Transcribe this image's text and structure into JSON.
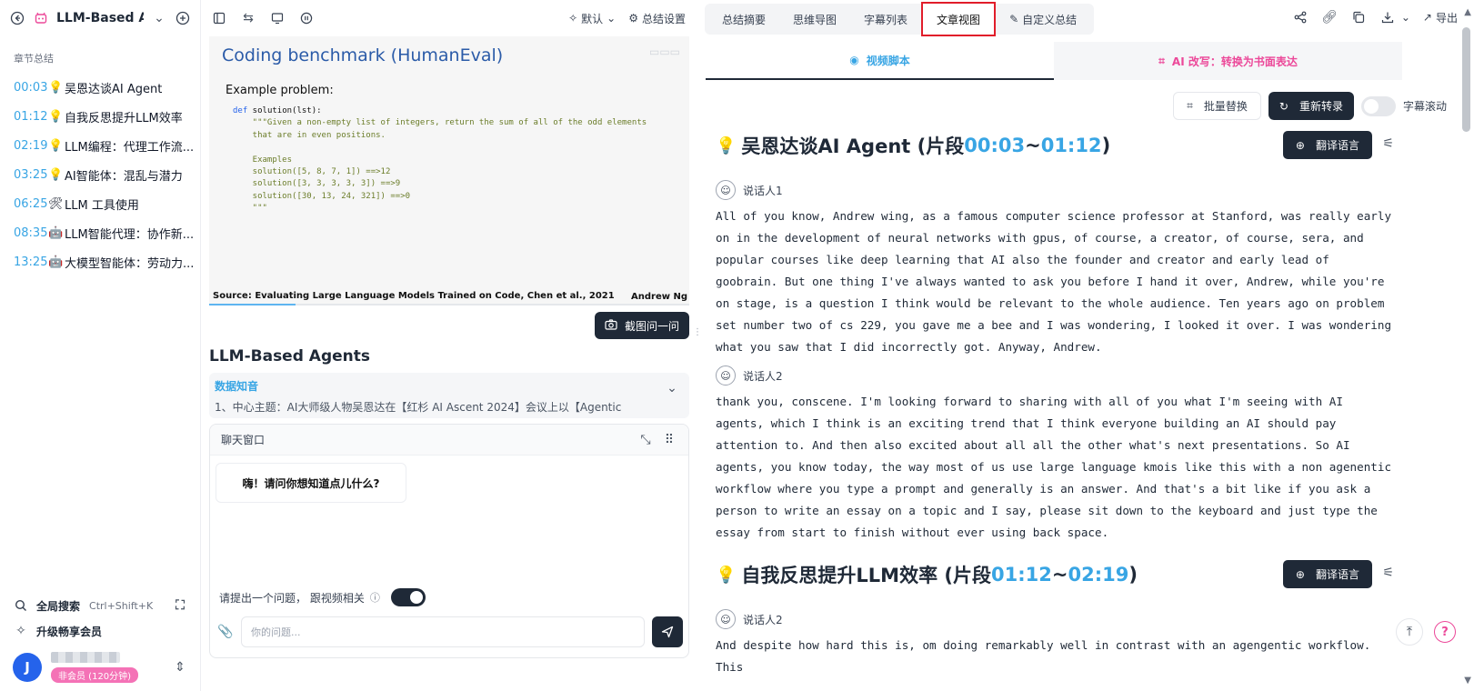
{
  "sidebar": {
    "title": "LLM-Based A...",
    "section_label": "章节总结",
    "chapters": [
      {
        "time": "00:03",
        "emoji": "💡",
        "label": "吴恩达谈AI Agent"
      },
      {
        "time": "01:12",
        "emoji": "💡",
        "label": "自我反思提升LLM效率"
      },
      {
        "time": "02:19",
        "emoji": "💡",
        "label": "LLM编程：代理工作流..."
      },
      {
        "time": "03:25",
        "emoji": "💡",
        "label": "AI智能体：混乱与潜力"
      },
      {
        "time": "06:25",
        "emoji": "🛠",
        "label": "LLM 工具使用"
      },
      {
        "time": "08:35",
        "emoji": "🤖",
        "label": "LLM智能代理：协作新..."
      },
      {
        "time": "13:25",
        "emoji": "🤖",
        "label": "大模型智能体：劳动力..."
      }
    ],
    "search_label": "全局搜索",
    "search_shortcut": "Ctrl+Shift+K",
    "upgrade_label": "升级畅享会员",
    "avatar_letter": "J",
    "member_badge": "非会员 (120分钟)"
  },
  "middle": {
    "toolbar": {
      "default_label": "默认",
      "settings_label": "总结设置"
    },
    "slide": {
      "title": "Coding benchmark (HumanEval)",
      "example": "Example problem:",
      "code_def_kw": "def",
      "code_def": " solution(lst):",
      "code_doc": "    \"\"\"Given a non-empty list of integers, return the sum of all of the odd elements\n    that are in even positions.\n\n    Examples\n    solution([5, 8, 7, 1]) ==>12\n    solution([3, 3, 3, 3, 3]) ==>9\n    solution([30, 13, 24, 321]) ==>0\n    \"\"\"",
      "source": "Source: Evaluating Large Language Models Trained on Code, Chen et al., 2021",
      "author": "Andrew Ng"
    },
    "progress": 0.18,
    "screenshot_button": "截图问一问",
    "heading": "LLM-Based Agents",
    "knowledge": {
      "title": "数据知音",
      "text": "1、中心主题：AI大师级人物吴恩达在【红杉 AI Ascent 2024】会议上以【Agentic"
    },
    "chat": {
      "title": "聊天窗口",
      "greeting": "嗨！请问你想知道点儿什么?",
      "ask_label": "请提出一个问题，  跟视频相关",
      "input_placeholder": "你的问题..."
    }
  },
  "right": {
    "tabs": [
      "总结摘要",
      "思维导图",
      "字幕列表",
      "文章视图",
      "自定义总结"
    ],
    "export_label": "导出",
    "subtabs": {
      "script": "视频脚本",
      "rewrite": "AI 改写：转换为书面表达"
    },
    "toolbar": {
      "batch_replace": "批量替换",
      "retranscribe": "重新转录",
      "scroll_label": "字幕滚动"
    },
    "translate_label": "翻译语言",
    "sections": [
      {
        "title": "吴恩达谈AI Agent (片段 ",
        "start": "00:03",
        "sep": "~",
        "end": "01:12",
        "close": ")",
        "speakers": [
          {
            "name": "说话人1",
            "text": "All of you know, Andrew wing, as a famous computer science professor at Stanford, was really early on in the development of neural networks with gpus, of course, a creator, of course, sera, and popular courses like deep learning that AI also the founder and creator and early lead of goobrain. But one thing I've always wanted to ask you before I hand it over, Andrew, while you're on stage, is a question I think would be relevant to the whole audience. Ten years ago on problem set number two of cs 229, you gave me a bee and I was wondering, I looked it over. I was wondering what you saw that I did incorrectly got. Anyway, Andrew."
          },
          {
            "name": "说话人2",
            "text": "thank you, conscene. I'm looking forward to sharing with all of you what I'm seeing with AI agents, which I think is an exciting trend that I think everyone building an AI should pay attention to. And then also excited about all all the other what's next presentations. So AI agents, you know today, the way most of us use large language kmois like this with a non agenentic workflow where you type a prompt and generally is an answer. And that's a bit like if you ask a person to write an essay on a topic and I say, please sit down to the keyboard and just type the essay from start to finish without ever using back space."
          }
        ]
      },
      {
        "title": "自我反思提升LLM效率 (片段 ",
        "start": "01:12",
        "sep": "~",
        "end": "02:19",
        "close": ")",
        "speakers": [
          {
            "name": "说话人2",
            "text": "And despite how hard this is, om doing remarkably well in contrast with an agengentic workflow. This"
          }
        ]
      }
    ]
  }
}
